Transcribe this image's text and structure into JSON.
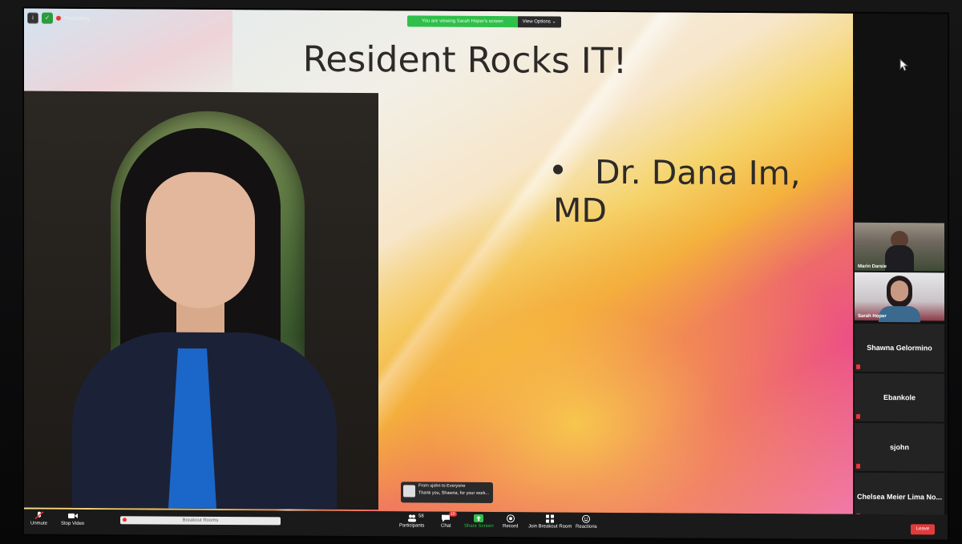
{
  "recording": {
    "label": "Recording"
  },
  "share_banner": {
    "message": "You are viewing Sarah Hoper's screen",
    "options_label": "View Options ⌄"
  },
  "slide": {
    "title": "Resident Rocks IT!",
    "bullet": "Dr. Dana Im, MD"
  },
  "participants_panel": {
    "video_tiles": [
      {
        "name": "Marin Darsie"
      },
      {
        "name": "Sarah Hoper"
      }
    ],
    "name_tiles": [
      {
        "name": "Shawna Gelormino"
      },
      {
        "name": "Ebankole"
      },
      {
        "name": "sjohn"
      },
      {
        "name": "Chelsea Meier Lima No..."
      }
    ]
  },
  "chat_popup": {
    "from": "From sjohn to Everyone",
    "message": "Thank you, Shawna, for your work..."
  },
  "toolbar": {
    "unmute": "Unmute",
    "stop_video": "Stop Video",
    "breakout_bar": "Breakout Rooms",
    "participants": "Participants",
    "participants_count": "58",
    "chat": "Chat",
    "chat_badge": "10",
    "share_screen": "Share Screen",
    "record": "Record",
    "join_breakout": "Join Breakout Room",
    "reactions": "Reactions",
    "leave": "Leave"
  },
  "colors": {
    "share_green": "#2fbf4a",
    "leave_red": "#e23b3b",
    "toolbar_bg": "#1a1a1a"
  },
  "icons": [
    "info-icon",
    "shield-icon",
    "mic-muted-icon",
    "video-camera-icon",
    "participants-icon",
    "chat-icon",
    "share-screen-icon",
    "record-icon",
    "breakout-grid-icon",
    "reactions-icon",
    "mouse-cursor-icon"
  ]
}
